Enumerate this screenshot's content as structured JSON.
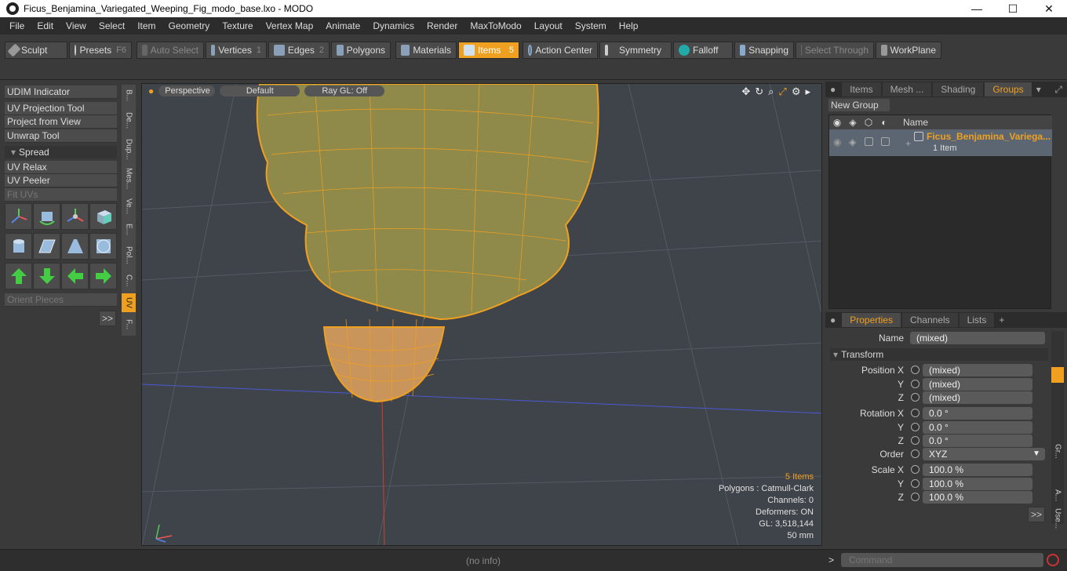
{
  "window": {
    "title": "Ficus_Benjamina_Variegated_Weeping_Fig_modo_base.lxo - MODO",
    "minimize": "—",
    "maximize": "☐",
    "close": "✕"
  },
  "menu": [
    "File",
    "Edit",
    "View",
    "Select",
    "Item",
    "Geometry",
    "Texture",
    "Vertex Map",
    "Animate",
    "Dynamics",
    "Render",
    "MaxToModo",
    "Layout",
    "System",
    "Help"
  ],
  "toolbar": {
    "sculpt": "Sculpt",
    "presets": "Presets",
    "presets_key": "F6",
    "auto_select": "Auto Select",
    "vertices": "Vertices",
    "vertices_key": "1",
    "edges": "Edges",
    "edges_key": "2",
    "polygons": "Polygons",
    "materials": "Materials",
    "items": "Items",
    "items_key": "5",
    "action_center": "Action Center",
    "symmetry": "Symmetry",
    "falloff": "Falloff",
    "snapping": "Snapping",
    "select_through": "Select Through",
    "workplane": "WorkPlane"
  },
  "left": {
    "udim": "UDIM Indicator",
    "uv_projection": "UV Projection Tool",
    "project_view": "Project from View",
    "unwrap": "Unwrap Tool",
    "spread": "Spread",
    "uv_relax": "UV Relax",
    "uv_peeler": "UV Peeler",
    "fit_uvs": "Fit UVs",
    "orient": "Orient Pieces",
    "more": ">>"
  },
  "vtabs": [
    "B...",
    "De...",
    "Dup...",
    "Mes...",
    "Ve...",
    "E...",
    "Pol...",
    "C...",
    "UV",
    "F..."
  ],
  "viewport": {
    "view": "Perspective",
    "shading": "Default",
    "raygl": "Ray GL: Off"
  },
  "info": {
    "items": "5 Items",
    "polygons": "Polygons : Catmull-Clark",
    "channels": "Channels: 0",
    "deformers": "Deformers: ON",
    "gl": "GL: 3,518,144",
    "focal": "50 mm"
  },
  "groups": {
    "tabs": [
      "Items",
      "Mesh ...",
      "Shading",
      "Groups"
    ],
    "new_group": "New Group",
    "col_name": "Name",
    "item_name": "Ficus_Benjamina_Variega...",
    "item_count": "1 Item"
  },
  "props": {
    "tabs": [
      "Properties",
      "Channels",
      "Lists"
    ],
    "add": "+",
    "name_label": "Name",
    "name_value": "(mixed)",
    "transform": "Transform",
    "pos_x_label": "Position X",
    "pos_x": "(mixed)",
    "pos_y": "(mixed)",
    "pos_z": "(mixed)",
    "rot_x_label": "Rotation X",
    "rot_x": "0.0 °",
    "rot_y": "0.0 °",
    "rot_z": "0.0 °",
    "order_label": "Order",
    "order": "XYZ",
    "scale_x_label": "Scale X",
    "scale_x": "100.0 %",
    "scale_y": "100.0 %",
    "scale_z": "100.0 %",
    "y": "Y",
    "z": "Z",
    "more": ">>"
  },
  "side_tabs": [
    "Gr...",
    "A...",
    "Use..."
  ],
  "status": {
    "info": "(no info)",
    "command_placeholder": "Command",
    "prompt": ">"
  }
}
